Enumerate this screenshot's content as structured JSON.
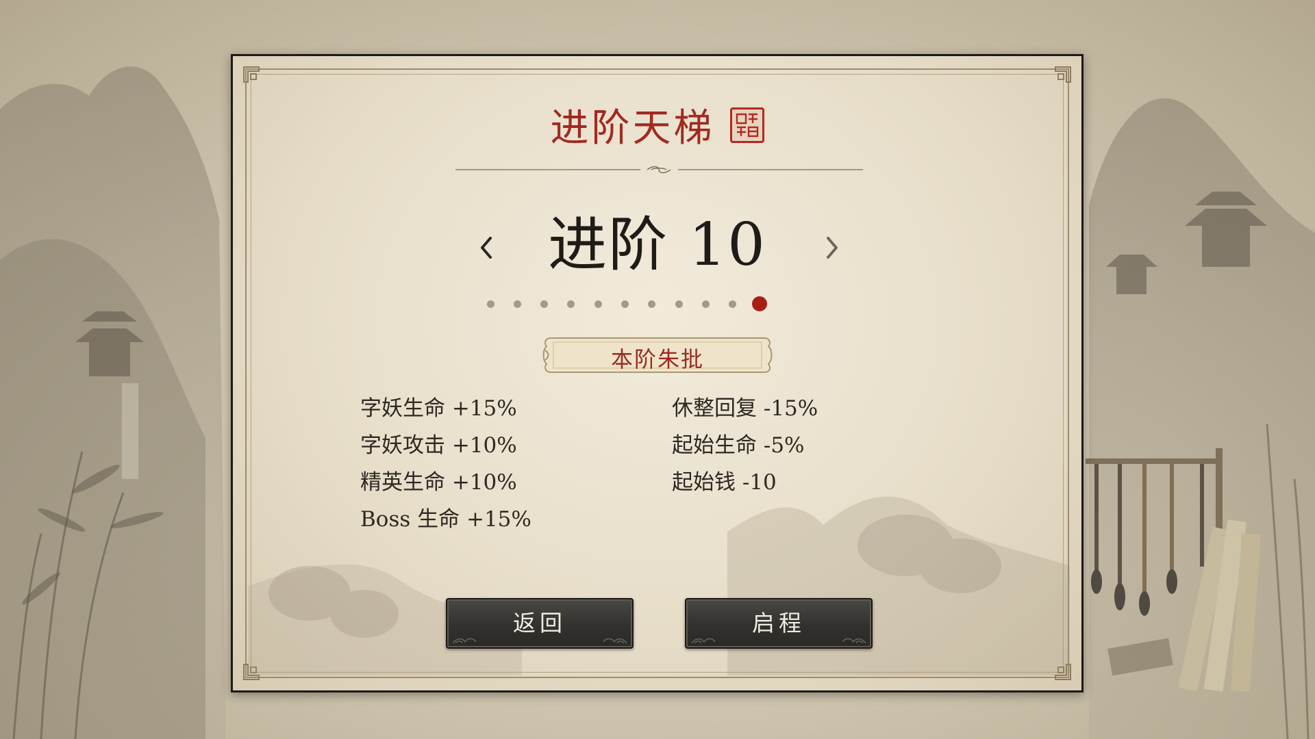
{
  "screen": {
    "title": "进阶天梯",
    "level_label": "进阶 10",
    "total_levels": 11,
    "current_level_index": 10,
    "section_heading": "本阶朱批"
  },
  "modifiers_left": [
    "字妖生命 +15%",
    "字妖攻击 +10%",
    "精英生命 +10%",
    "Boss 生命 +15%"
  ],
  "modifiers_right": [
    "休整回复 -15%",
    "起始生命 -5%",
    "起始钱 -10"
  ],
  "buttons": {
    "back_label": "返回",
    "start_label": "启程"
  },
  "icons": {
    "prev": "chevron-left-icon",
    "next": "chevron-right-icon",
    "seal": "seal-stamp-icon"
  },
  "colors": {
    "title_red": "#a12a20",
    "active_dot": "#a81f16",
    "inactive_dot": "#a39a8a",
    "button_bg": "#33312e"
  }
}
